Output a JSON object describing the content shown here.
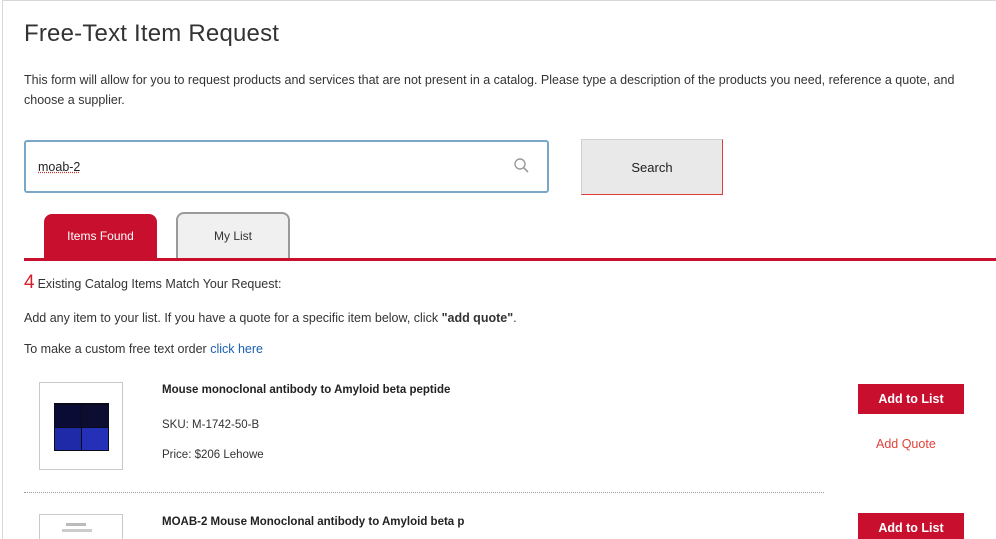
{
  "page": {
    "title": "Free-Text Item Request",
    "description": "This form will allow for you to request products and services that are not present in a catalog. Please type a description of the products you need, reference a quote, and choose a supplier."
  },
  "search": {
    "value": "moab-2",
    "button_label": "Search"
  },
  "tabs": [
    {
      "label": "Items Found",
      "active": true
    },
    {
      "label": "My List",
      "active": false
    }
  ],
  "results": {
    "count": "4",
    "match_text": "Existing Catalog Items Match Your Request:",
    "info_prefix": "Add any item to your list. If you have a quote for a specific item below, click ",
    "info_bold": "\"add quote\"",
    "info_suffix": ".",
    "custom_prefix": "To make a custom free text order ",
    "custom_link": "click here",
    "items": [
      {
        "name": "Mouse monoclonal antibody to Amyloid beta peptide",
        "sku": "SKU: M-1742-50-B",
        "price": "Price: $206 Lehowe",
        "add_label": "Add to List",
        "quote_label": "Add Quote"
      },
      {
        "name": "MOAB-2 Mouse Monoclonal antibody to Amyloid beta p",
        "add_label": "Add to List"
      }
    ]
  },
  "colors": {
    "brand_red": "#c8102e",
    "link_blue": "#1a5fb4",
    "search_border": "#7aa7c7"
  },
  "icons": {
    "search": "search-icon",
    "thumbnail": "product-image"
  }
}
